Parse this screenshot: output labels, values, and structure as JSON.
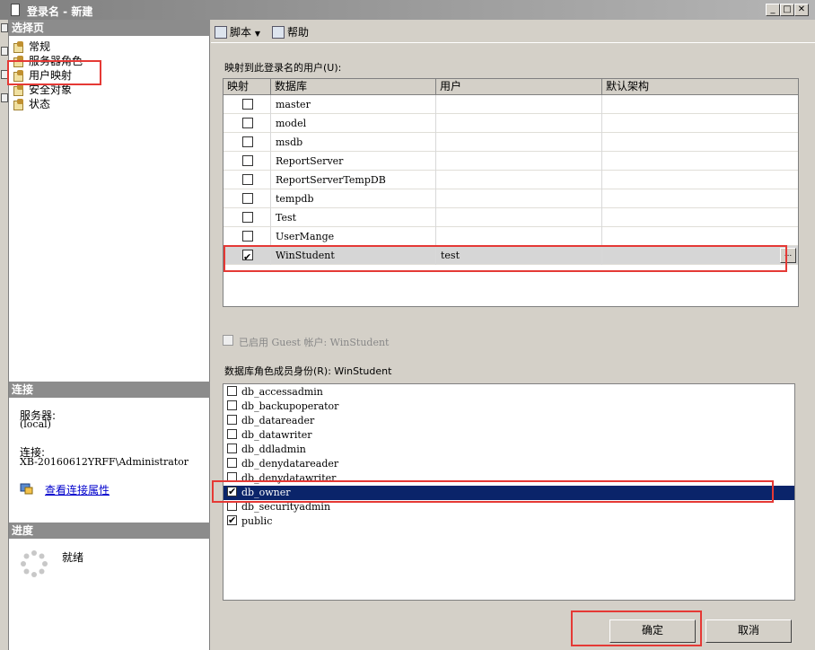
{
  "window": {
    "title": "登录名 - 新建",
    "controls": [
      "_",
      "□",
      "✕"
    ]
  },
  "left_panel": {
    "select_page_header": "选择页",
    "pages": [
      {
        "label": "常规",
        "icon": "page-icon"
      },
      {
        "label": "服务器角色",
        "icon": "page-icon"
      },
      {
        "label": "用户映射",
        "icon": "page-icon"
      },
      {
        "label": "安全对象",
        "icon": "page-icon"
      },
      {
        "label": "状态",
        "icon": "page-icon"
      }
    ],
    "connection_header": "连接",
    "server_label": "服务器:",
    "server_value": "(local)",
    "connection_label": "连接:",
    "connection_value": "XB-20160612YRFF\\Administrator",
    "view_props_link": "查看连接属性",
    "progress_header": "进度",
    "progress_status": "就绪"
  },
  "toolbar": {
    "script_label": "脚本",
    "help_label": "帮助"
  },
  "mapping": {
    "label": "映射到此登录名的用户(U):",
    "columns": [
      "映射",
      "数据库",
      "用户",
      "默认架构"
    ],
    "rows": [
      {
        "mapped": false,
        "database": "master",
        "user": "",
        "schema": ""
      },
      {
        "mapped": false,
        "database": "model",
        "user": "",
        "schema": ""
      },
      {
        "mapped": false,
        "database": "msdb",
        "user": "",
        "schema": ""
      },
      {
        "mapped": false,
        "database": "ReportServer",
        "user": "",
        "schema": ""
      },
      {
        "mapped": false,
        "database": "ReportServerTempDB",
        "user": "",
        "schema": ""
      },
      {
        "mapped": false,
        "database": "tempdb",
        "user": "",
        "schema": ""
      },
      {
        "mapped": false,
        "database": "Test",
        "user": "",
        "schema": ""
      },
      {
        "mapped": false,
        "database": "UserMange",
        "user": "",
        "schema": ""
      },
      {
        "mapped": true,
        "database": "WinStudent",
        "user": "test",
        "schema": "",
        "selected": true
      }
    ],
    "ellipsis": "..."
  },
  "guest": {
    "label": "已启用 Guest 帐户: WinStudent",
    "checked": false
  },
  "roles": {
    "label": "数据库角色成员身份(R): WinStudent",
    "items": [
      {
        "name": "db_accessadmin",
        "checked": false
      },
      {
        "name": "db_backupoperator",
        "checked": false
      },
      {
        "name": "db_datareader",
        "checked": false
      },
      {
        "name": "db_datawriter",
        "checked": false
      },
      {
        "name": "db_ddladmin",
        "checked": false
      },
      {
        "name": "db_denydatareader",
        "checked": false
      },
      {
        "name": "db_denydatawriter",
        "checked": false
      },
      {
        "name": "db_owner",
        "checked": true,
        "selected": true
      },
      {
        "name": "db_securityadmin",
        "checked": false
      },
      {
        "name": "public",
        "checked": true
      }
    ]
  },
  "buttons": {
    "ok": "确定",
    "cancel": "取消"
  },
  "colors": {
    "selection": "#0a246a",
    "highlight_box": "#e53935",
    "header_bar": "#8c8c8c"
  }
}
